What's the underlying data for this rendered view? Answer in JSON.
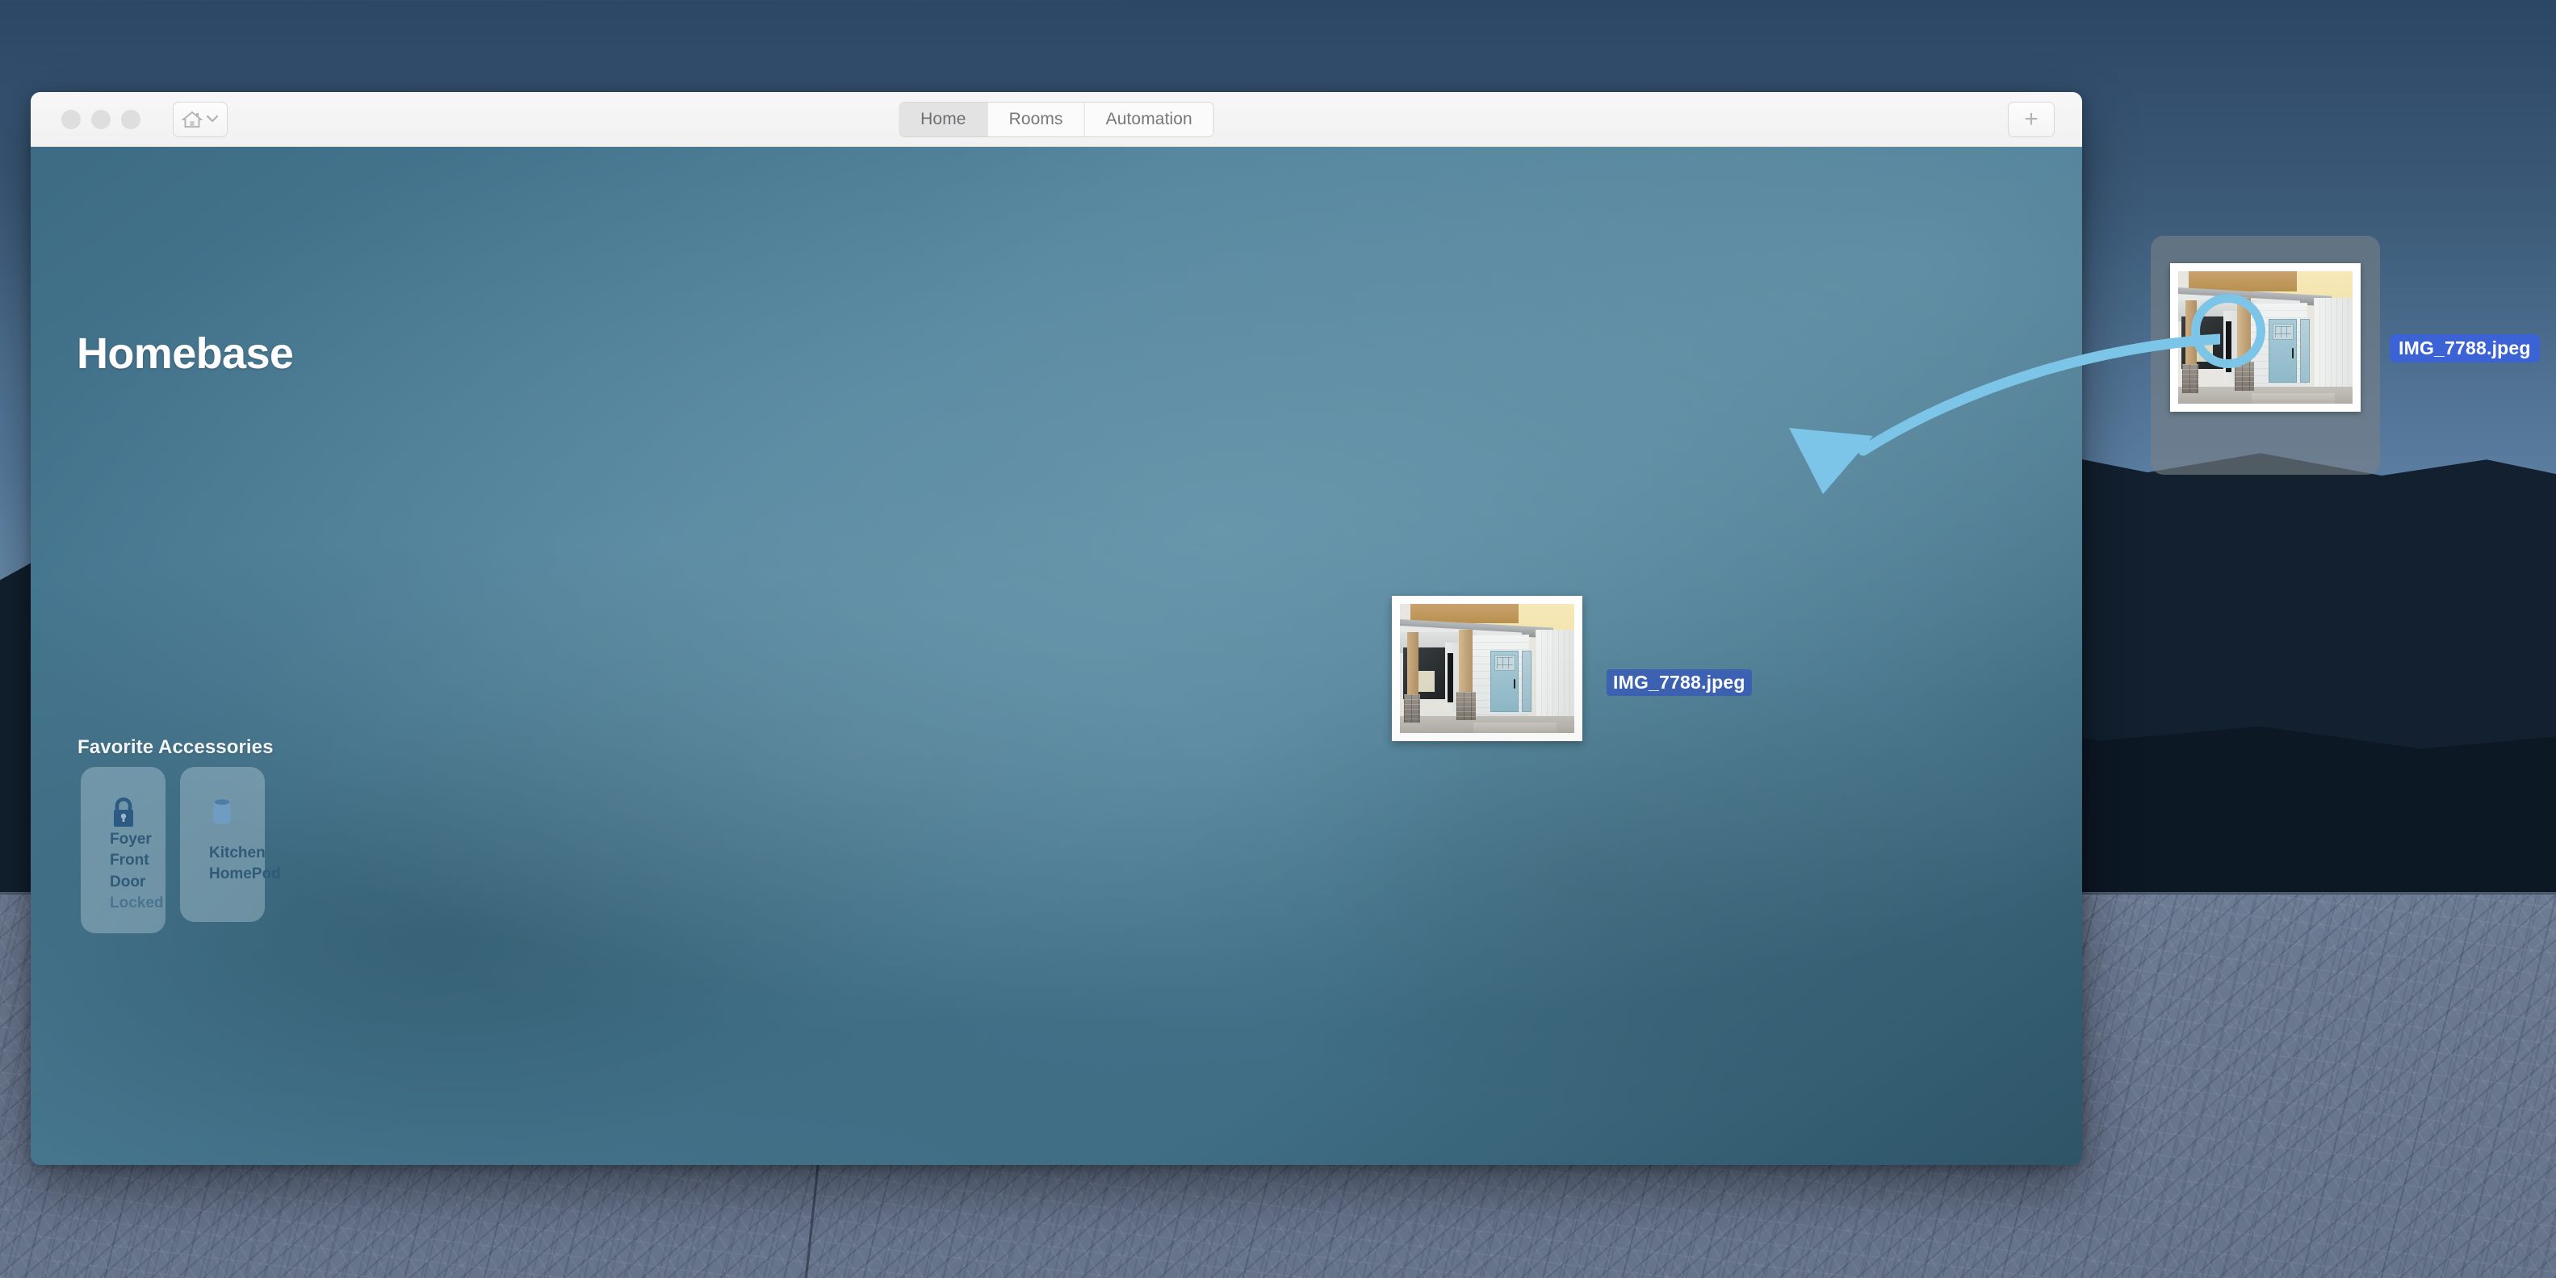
{
  "window": {
    "traffic_lights": [
      "close",
      "minimize",
      "zoom"
    ],
    "home_button_icon": "house-icon",
    "home_button_chevron": "chevron-down-icon",
    "tabs": [
      {
        "label": "Home",
        "selected": true
      },
      {
        "label": "Rooms",
        "selected": false
      },
      {
        "label": "Automation",
        "selected": false
      }
    ],
    "add_button_label": "+"
  },
  "home": {
    "title": "Homebase",
    "favorites_heading": "Favorite Accessories",
    "accessories": [
      {
        "icon": "lock-closed-icon",
        "room": "Foyer",
        "name": "Front Door",
        "state": "Locked"
      },
      {
        "icon": "homepod-icon",
        "room": "Kitchen",
        "name": "HomePod",
        "state": ""
      }
    ]
  },
  "drag": {
    "filename": "IMG_7788.jpeg",
    "thumbnail_alt": "house-porch-photo"
  },
  "desktop": {
    "file_icon": {
      "filename": "IMG_7788.jpeg",
      "selected": true,
      "thumbnail_alt": "house-porch-photo"
    },
    "annotation": {
      "circle": "highlight-circle",
      "arrow": "drag-direction-arrow",
      "color": "#7cc5e9"
    }
  },
  "colors": {
    "accent_blue": "#3b63d6",
    "drag_label_blue": "#3456be",
    "annotation_blue": "#7cc5e9",
    "app_background": "#4a7f99",
    "tile_text": "#2f5a78"
  }
}
